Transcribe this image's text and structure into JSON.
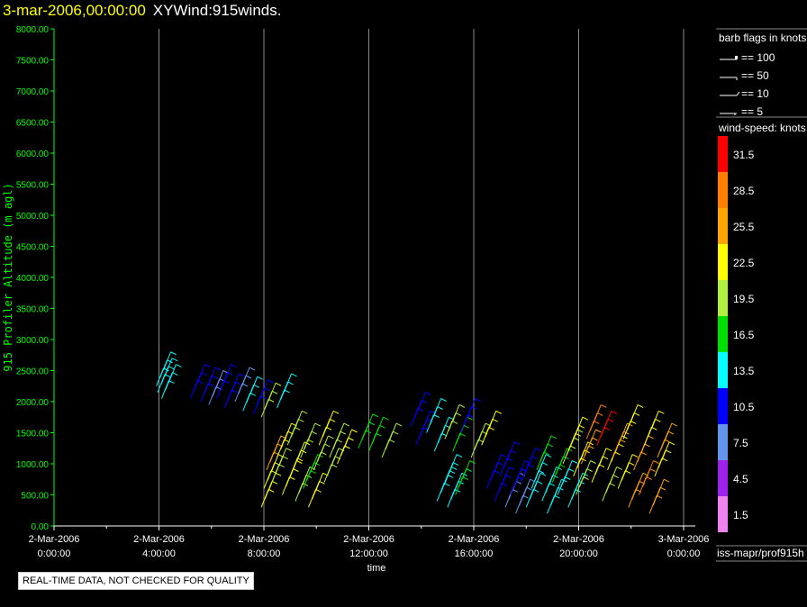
{
  "header": {
    "date": "3-mar-2006,00:00:00",
    "title": "XYWind:915winds."
  },
  "note": "REAL-TIME DATA, NOT CHECKED FOR QUALITY",
  "source": "iss-mapr/prof915h",
  "barb_legend": {
    "title": "barb flags in knots",
    "items": [
      "== 100",
      "== 50",
      "== 10",
      "== 5"
    ]
  },
  "chart_data": {
    "type": "wind-barb",
    "ylabel": "915 Profiler Altitude (m agl)",
    "xlabel": "time",
    "ylim": [
      0,
      8000
    ],
    "yticks": [
      "0.00",
      "500.00",
      "1000.00",
      "1500.00",
      "2000.00",
      "2500.00",
      "3000.00",
      "3500.00",
      "4000.00",
      "4500.00",
      "5000.00",
      "5500.00",
      "6000.00",
      "6500.00",
      "7000.00",
      "7500.00",
      "8000.00"
    ],
    "xlim_hours": [
      0,
      24
    ],
    "xticks": [
      [
        "2-Mar-2006",
        "0:00:00"
      ],
      [
        "2-Mar-2006",
        "4:00:00"
      ],
      [
        "2-Mar-2006",
        "8:00:00"
      ],
      [
        "2-Mar-2006",
        "12:00:00"
      ],
      [
        "2-Mar-2006",
        "16:00:00"
      ],
      [
        "2-Mar-2006",
        "20:00:00"
      ],
      [
        "3-Mar-2006",
        "0:00:00"
      ]
    ],
    "grid": "vertical",
    "colorbar": {
      "title": "wind-speed: knots",
      "labels": [
        "31.5",
        "28.5",
        "25.5",
        "22.5",
        "19.5",
        "16.5",
        "13.5",
        "10.5",
        "7.5",
        "4.5",
        "1.5"
      ],
      "colors": [
        "#ff0000",
        "#ff8000",
        "#ffa500",
        "#ffff00",
        "#b0f040",
        "#00e000",
        "#00ffff",
        "#0000ff",
        "#6495ed",
        "#a020f0",
        "#ee82ee"
      ]
    },
    "points_hour_alt_speed": [
      [
        3.9,
        2250,
        14
      ],
      [
        3.95,
        2150,
        15
      ],
      [
        4.1,
        2050,
        13
      ],
      [
        5.2,
        2050,
        10
      ],
      [
        5.6,
        2000,
        11
      ],
      [
        5.9,
        1950,
        9
      ],
      [
        6.2,
        2050,
        10
      ],
      [
        6.5,
        1900,
        12
      ],
      [
        6.9,
        2000,
        8
      ],
      [
        7.2,
        1850,
        13
      ],
      [
        7.6,
        1800,
        10
      ],
      [
        7.9,
        1750,
        21
      ],
      [
        8.5,
        1900,
        14
      ],
      [
        7.9,
        300,
        22
      ],
      [
        8.0,
        600,
        24
      ],
      [
        8.1,
        900,
        26
      ],
      [
        8.3,
        700,
        21
      ],
      [
        8.5,
        1100,
        22
      ],
      [
        8.7,
        500,
        23
      ],
      [
        8.9,
        1300,
        20
      ],
      [
        9.0,
        800,
        22
      ],
      [
        9.2,
        400,
        21
      ],
      [
        9.4,
        1100,
        19
      ],
      [
        9.5,
        600,
        18
      ],
      [
        9.7,
        300,
        22
      ],
      [
        9.9,
        900,
        20
      ],
      [
        10.1,
        1300,
        23
      ],
      [
        10.3,
        700,
        21
      ],
      [
        10.5,
        1100,
        19
      ],
      [
        10.8,
        1000,
        22
      ],
      [
        11.6,
        1250,
        17
      ],
      [
        12.0,
        1200,
        16
      ],
      [
        12.5,
        1100,
        20
      ],
      [
        13.6,
        1600,
        12
      ],
      [
        13.8,
        1300,
        11
      ],
      [
        14.2,
        1500,
        13
      ],
      [
        14.5,
        1200,
        15
      ],
      [
        14.6,
        400,
        14
      ],
      [
        14.8,
        600,
        15
      ],
      [
        15.0,
        300,
        13
      ],
      [
        15.3,
        500,
        17
      ],
      [
        14.9,
        1400,
        20
      ],
      [
        15.2,
        1200,
        17
      ],
      [
        15.5,
        1500,
        12
      ],
      [
        15.9,
        1100,
        19
      ],
      [
        16.3,
        1300,
        23
      ],
      [
        16.5,
        600,
        12
      ],
      [
        16.8,
        400,
        10
      ],
      [
        17.0,
        800,
        11
      ],
      [
        17.2,
        300,
        9
      ],
      [
        17.4,
        500,
        10
      ],
      [
        17.6,
        200,
        8
      ],
      [
        17.8,
        700,
        11
      ],
      [
        18.0,
        300,
        13
      ],
      [
        18.2,
        600,
        14
      ],
      [
        18.4,
        900,
        16
      ],
      [
        18.6,
        400,
        13
      ],
      [
        18.8,
        200,
        15
      ],
      [
        19.0,
        700,
        17
      ],
      [
        19.2,
        500,
        14
      ],
      [
        19.4,
        1000,
        20
      ],
      [
        19.6,
        300,
        15
      ],
      [
        19.8,
        800,
        22
      ],
      [
        19.6,
        1200,
        24
      ],
      [
        19.9,
        500,
        21
      ],
      [
        20.1,
        1000,
        25
      ],
      [
        20.3,
        1400,
        30
      ],
      [
        20.5,
        700,
        22
      ],
      [
        20.7,
        1300,
        31
      ],
      [
        20.9,
        400,
        20
      ],
      [
        21.1,
        900,
        24
      ],
      [
        21.3,
        1100,
        27
      ],
      [
        21.5,
        600,
        23
      ],
      [
        21.7,
        1400,
        22
      ],
      [
        21.9,
        300,
        26
      ],
      [
        22.1,
        900,
        25
      ],
      [
        22.3,
        500,
        28
      ],
      [
        22.5,
        1300,
        22
      ],
      [
        22.7,
        200,
        27
      ],
      [
        22.9,
        800,
        24
      ],
      [
        23.0,
        1100,
        26
      ]
    ]
  }
}
